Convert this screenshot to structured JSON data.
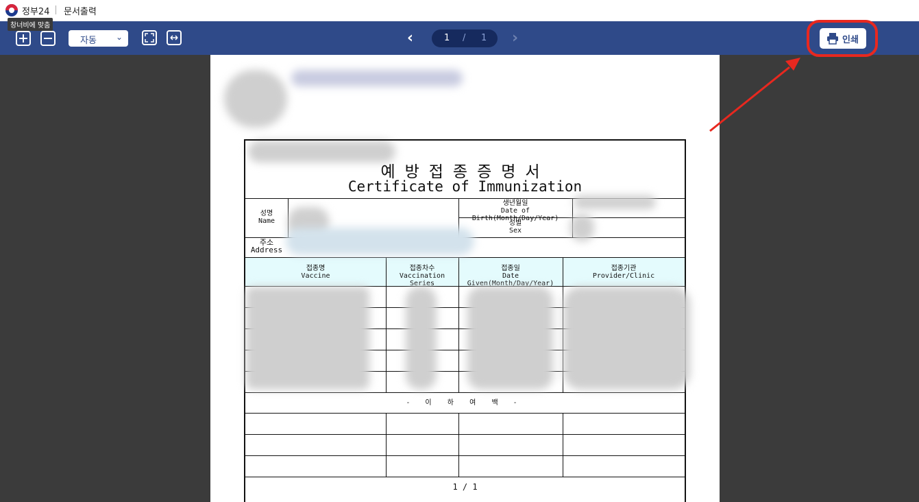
{
  "title_bar": {
    "app_name": "정부24",
    "doc_name": "문서출력",
    "tooltip": "창너비에 맞춤"
  },
  "toolbar": {
    "zoom_in_icon": "plus-icon",
    "zoom_out_icon": "minus-icon",
    "zoom_value": "자동",
    "fit_page_icon": "fit-page-icon",
    "fit_width_icon": "fit-width-icon",
    "current_page": "1",
    "page_separator": "/",
    "total_pages": "1",
    "print_label": "인쇄",
    "accent": "#2f4a89",
    "highlight": "#e8281f"
  },
  "certificate": {
    "title_ko": "예방접종증명서",
    "title_en": "Certificate of Immunization",
    "name_ko": "성명",
    "name_en": "Name",
    "dob_ko": "생년월일",
    "dob_en": "Date of Birth(Month/Day/Year)",
    "sex_ko": "성별",
    "sex_en": "Sex",
    "address_ko": "주소",
    "address_en": "Address",
    "columns": [
      {
        "ko": "접종명",
        "en": "Vaccine"
      },
      {
        "ko": "접종차수",
        "en": "Vaccination Series"
      },
      {
        "ko": "접종일",
        "en": "Date Given(Month/Day/Year)"
      },
      {
        "ko": "접종기관",
        "en": "Provider/Clinic"
      }
    ],
    "end_marker": "- 이 하 여 백 -",
    "page_footer": "1 / 1"
  }
}
